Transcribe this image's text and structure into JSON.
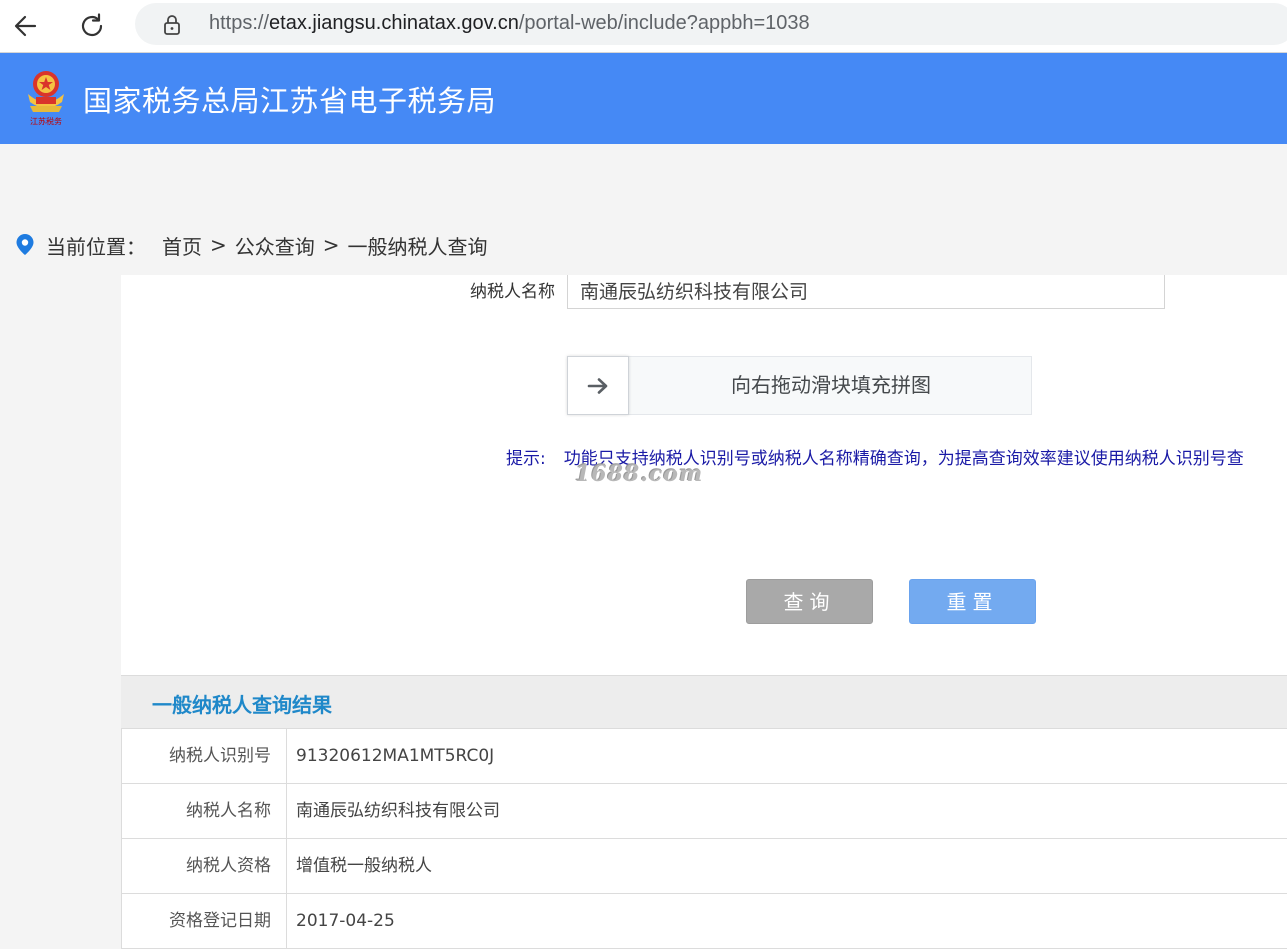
{
  "browser": {
    "url_prefix": "https://",
    "url_domain": "etax.jiangsu.chinatax.gov.cn",
    "url_path": "/portal-web/include?appbh=1038"
  },
  "header": {
    "title": "国家税务总局江苏省电子税务局",
    "emblem_text": "江苏税务"
  },
  "breadcrumb": {
    "label": "当前位置：",
    "items": [
      "首页",
      "公众查询",
      "一般纳税人查询"
    ],
    "separator": ">"
  },
  "form": {
    "name_label": "纳税人名称",
    "name_value": "南通辰弘纺织科技有限公司",
    "slider_text": "向右拖动滑块填充拼图",
    "hint_label": "提示:",
    "hint_text": "功能只支持纳税人识别号或纳税人名称精确查询，为提高查询效率建议使用纳税人识别号查",
    "watermark": "1688.com",
    "query_button": "查询",
    "reset_button": "重置"
  },
  "results": {
    "title": "一般纳税人查询结果",
    "rows": [
      {
        "label": "纳税人识别号",
        "value": "91320612MA1MT5RC0J"
      },
      {
        "label": "纳税人名称",
        "value": "南通辰弘纺织科技有限公司"
      },
      {
        "label": "纳税人资格",
        "value": "增值税一般纳税人"
      },
      {
        "label": "资格登记日期",
        "value": "2017-04-25"
      }
    ]
  },
  "colors": {
    "header_bg": "#4589f5",
    "results_title": "#1f88c9",
    "hint": "#1a1aa6",
    "query_btn": "#a9a9a9",
    "reset_btn": "#73aaf0"
  }
}
